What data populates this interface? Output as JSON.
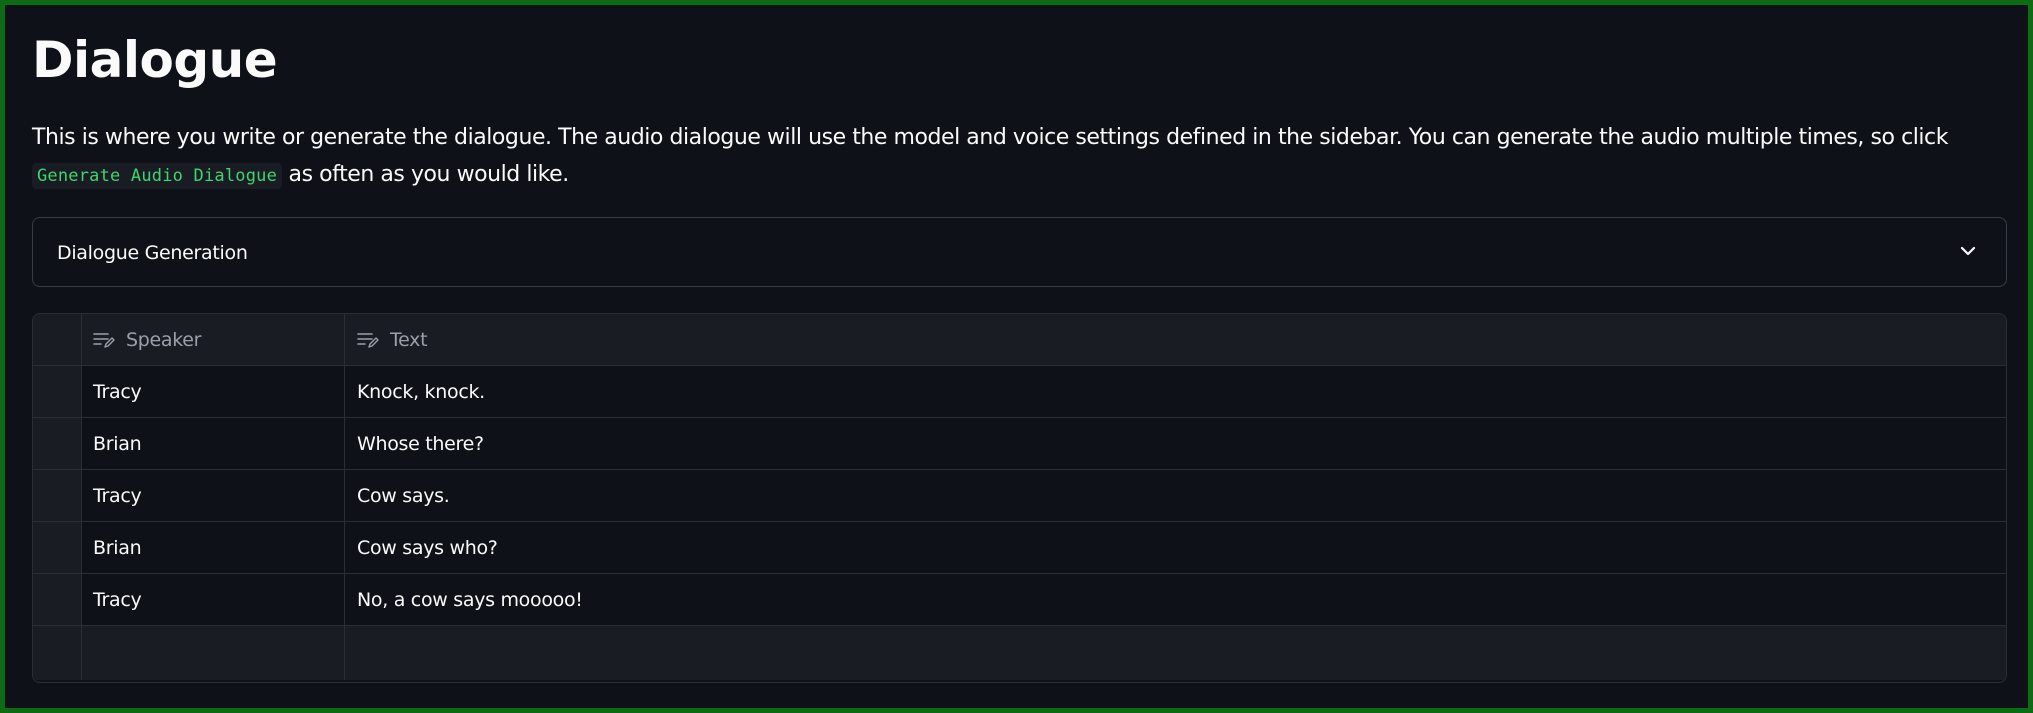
{
  "page": {
    "title": "Dialogue",
    "description_before": "This is where you write or generate the dialogue. The audio dialogue will use the model and voice settings defined in the sidebar. You can generate the audio multiple times, so click ",
    "code_chip": "Generate Audio Dialogue",
    "description_after": " as often as you would like."
  },
  "expander": {
    "label": "Dialogue Generation",
    "icon": "chevron-down-icon",
    "expanded": false
  },
  "table": {
    "columns": [
      {
        "label": "Speaker",
        "icon": "edit-text-icon"
      },
      {
        "label": "Text",
        "icon": "edit-text-icon"
      }
    ],
    "rows": [
      {
        "speaker": "Tracy",
        "text": "Knock, knock."
      },
      {
        "speaker": "Brian",
        "text": "Whose there?"
      },
      {
        "speaker": "Tracy",
        "text": "Cow says."
      },
      {
        "speaker": "Brian",
        "text": "Cow says who?"
      },
      {
        "speaker": "Tracy",
        "text": "No, a cow says mooooo!"
      }
    ]
  },
  "colors": {
    "background": "#0e1117",
    "frame": "#0d6b13",
    "code_text": "#3dd56d",
    "header_bg": "#1a1c23"
  }
}
